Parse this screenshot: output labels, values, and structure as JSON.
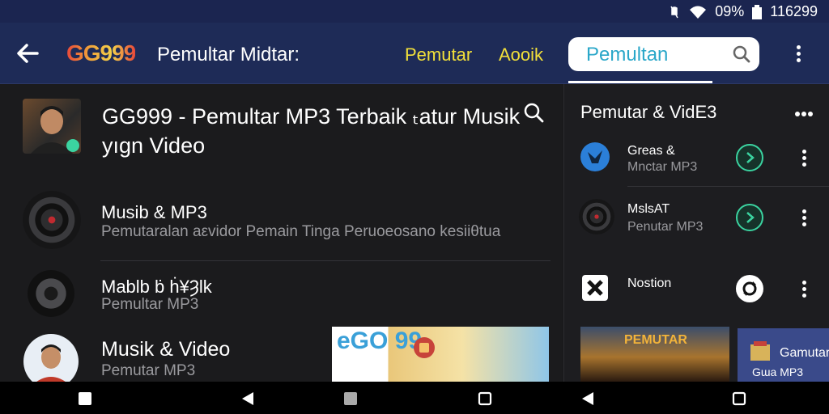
{
  "status": {
    "battery": "09%",
    "time": "116299"
  },
  "appbar": {
    "logo": "GG999",
    "title": "Pemultar Midtar:",
    "tabs": [
      "Pemutar",
      "Aooik"
    ],
    "search_value": "Pemultan"
  },
  "header": {
    "title": "GG999 - Pemultar MP3 Terbaik ₜatur Musik yıgn Video"
  },
  "list": [
    {
      "title": "Musib & MP3",
      "subtitle": "Pemutaralan aεvidor Pemain Tinga Peruoeosano kesiiθtua"
    },
    {
      "title": "Mablb ḃ ḣ¥Ȝlk",
      "subtitle": "Pemultar MP3"
    },
    {
      "title": "Musik & Video",
      "subtitle": "Pemutar MP3"
    }
  ],
  "thumb": {
    "text": "eGO 99"
  },
  "side": {
    "title": "Pemutar & VidE3",
    "items": [
      {
        "title": "Greas &",
        "subtitle": "Mnctar MP3"
      },
      {
        "title": "MslsAT",
        "subtitle": "Penutar MP3"
      },
      {
        "title": "Nostion",
        "subtitle": ""
      }
    ],
    "concert_text": "PEMUTAR",
    "card_title": "Gamutar",
    "card_sub": "Gɯa MP3"
  },
  "colors": {
    "appbar": "#1e2b57",
    "tab_text": "#f2e03a",
    "search_text": "#2aa7c9",
    "accent_teal": "#3bd3a0"
  }
}
